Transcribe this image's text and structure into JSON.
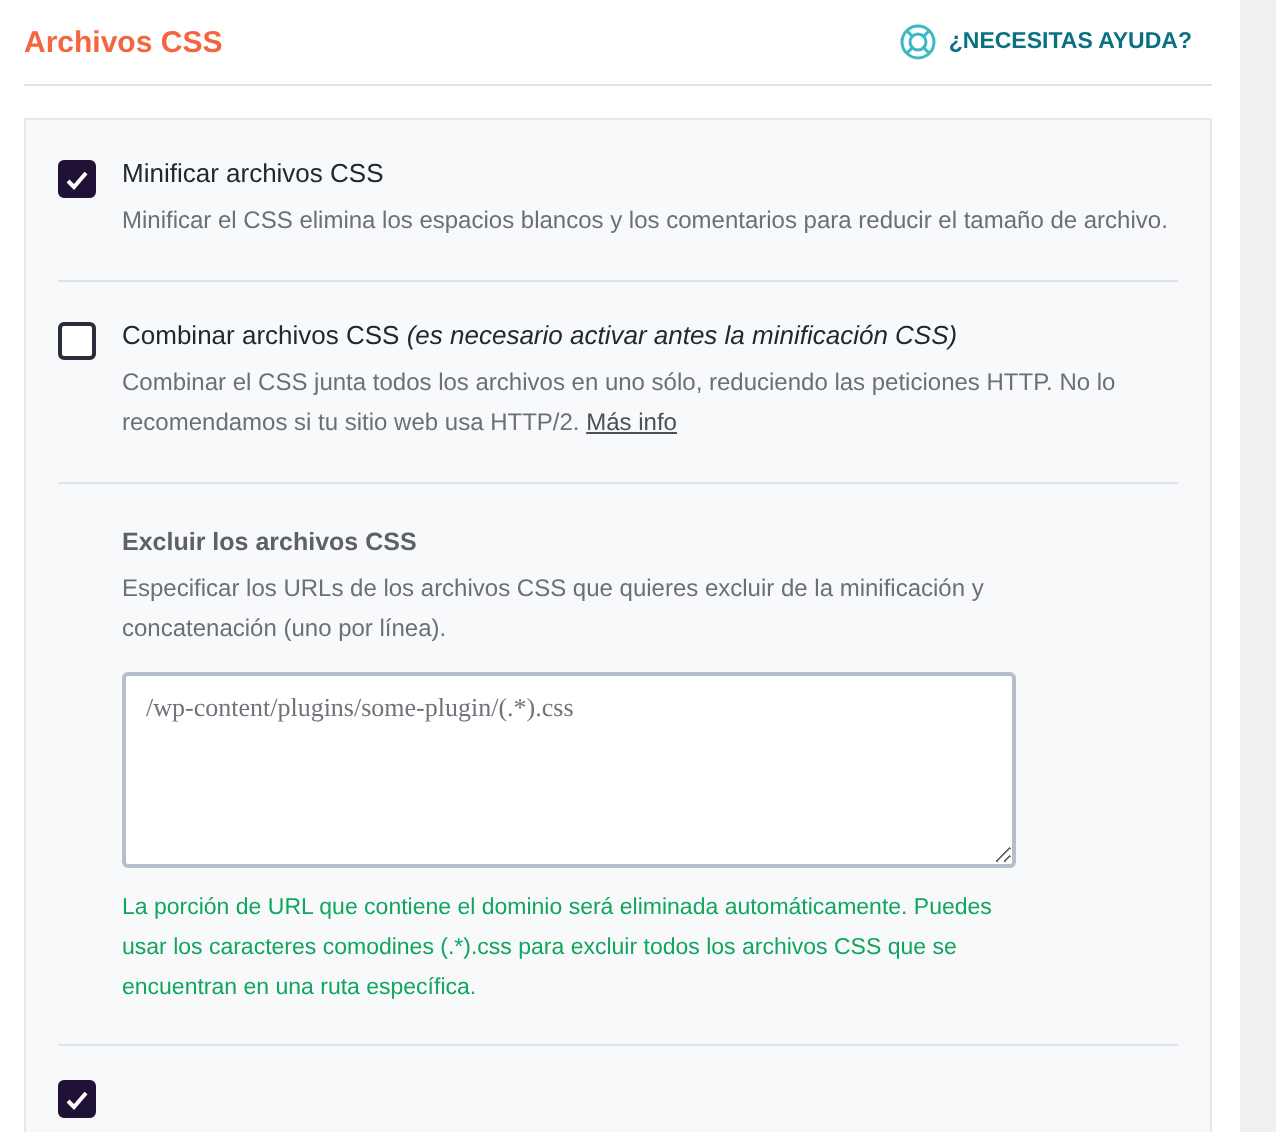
{
  "header": {
    "title": "Archivos CSS",
    "help_link": "¿NECESITAS AYUDA?"
  },
  "options": [
    {
      "kind": "option",
      "checked": true,
      "label": "Minificar archivos CSS",
      "description": "Minificar el CSS elimina los espacios blancos y los comentarios para reducir el tamaño de archivo."
    },
    {
      "kind": "option",
      "checked": false,
      "label": "Combinar archivos CSS *(es necesario activar antes la minificación CSS)*",
      "description": "Combinar el CSS junta todos los archivos en uno sólo, reduciendo las peticiones HTTP. No lo recomendamos si tu sitio web usa HTTP/2.",
      "link": "Más info"
    },
    {
      "kind": "exclude",
      "title": "Excluir los archivos CSS",
      "description": "Especificar los URLs de los archivos CSS que quieres excluir de la minificación y concatenación (uno por línea).",
      "placeholder": "/wp-content/plugins/some-plugin/(.*).css",
      "note": "La porción de URL que contiene el dominio será eliminada automáticamente. Puedes usar los caracteres comodines (.*).css para excluir todos los archivos CSS que se encuentran en una ruta específica."
    },
    {
      "kind": "cut_option",
      "checked": true
    }
  ]
}
